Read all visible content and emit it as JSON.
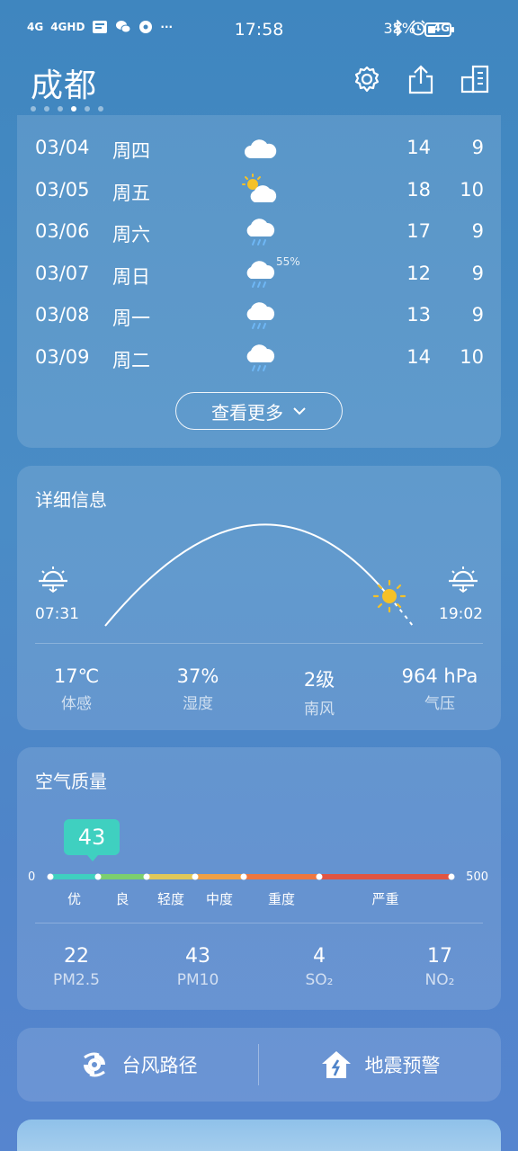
{
  "status_bar": {
    "signal1": "4G",
    "signal2": "4GHD",
    "more": "···",
    "time": "17:58",
    "network": "4G",
    "battery": "35%",
    "battery_level": 0.35
  },
  "header": {
    "city": "成都",
    "pages": 6,
    "active_page": 4
  },
  "forecast": {
    "rows": [
      {
        "date": "03/04",
        "weekday": "周四",
        "icon": "cloudy-icon",
        "pct": "",
        "hi": "14",
        "lo": "9"
      },
      {
        "date": "03/05",
        "weekday": "周五",
        "icon": "partly-cloudy-icon",
        "pct": "",
        "hi": "18",
        "lo": "10"
      },
      {
        "date": "03/06",
        "weekday": "周六",
        "icon": "light-rain-icon",
        "pct": "",
        "hi": "17",
        "lo": "9"
      },
      {
        "date": "03/07",
        "weekday": "周日",
        "icon": "light-rain-icon",
        "pct": "55%",
        "hi": "12",
        "lo": "9"
      },
      {
        "date": "03/08",
        "weekday": "周一",
        "icon": "light-rain-icon",
        "pct": "",
        "hi": "13",
        "lo": "9"
      },
      {
        "date": "03/09",
        "weekday": "周二",
        "icon": "light-rain-icon",
        "pct": "",
        "hi": "14",
        "lo": "10"
      }
    ],
    "more_label": "查看更多"
  },
  "details": {
    "title": "详细信息",
    "sunrise": "07:31",
    "sunset": "19:02",
    "stats": [
      {
        "value": "17℃",
        "label": "体感"
      },
      {
        "value": "37%",
        "label": "湿度"
      },
      {
        "value": "2级",
        "label": "南风"
      },
      {
        "value": "964 hPa",
        "label": "气压"
      }
    ]
  },
  "air": {
    "title": "空气质量",
    "aqi": "43",
    "scale_min": "0",
    "scale_max": "500",
    "levels": [
      "优",
      "良",
      "轻度",
      "中度",
      "重度",
      "严重"
    ],
    "level_colors": [
      "#3fd0c0",
      "#7ccf6f",
      "#e0c85a",
      "#f0a046",
      "#ee7740",
      "#e05543"
    ],
    "pollutants": [
      {
        "value": "22",
        "label": "PM2.5"
      },
      {
        "value": "43",
        "label": "PM10"
      },
      {
        "value": "4",
        "label": "SO₂"
      },
      {
        "value": "17",
        "label": "NO₂"
      }
    ]
  },
  "links": {
    "typhoon": "台风路径",
    "earthquake": "地震预警"
  }
}
